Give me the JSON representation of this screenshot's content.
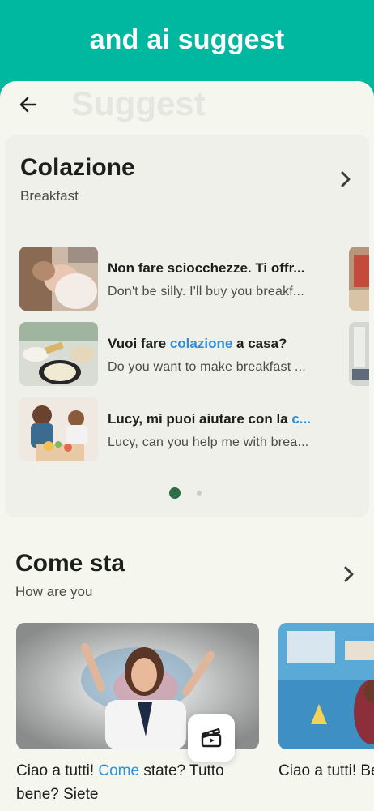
{
  "banner": {
    "title": "and ai suggest"
  },
  "header": {
    "ghost_title": "Suggest"
  },
  "breakfast": {
    "title": "Colazione",
    "subtitle": "Breakfast",
    "phrases": [
      {
        "italian": "Non fare sciocchezze. Ti offr...",
        "english": "Don't be silly. I'll buy you breakf..."
      },
      {
        "italian_before": "Vuoi fare ",
        "italian_highlight": "colazione",
        "italian_after": " a casa?",
        "english": "Do you want to make breakfast ..."
      },
      {
        "italian_before": "Lucy, mi puoi aiutare con la ",
        "italian_highlight": "c...",
        "english": "Lucy, can you help me with brea..."
      }
    ],
    "page_count": 2,
    "active_page": 1
  },
  "how_are_you": {
    "title": "Come sta",
    "subtitle": "How are you",
    "videos": [
      {
        "caption_before": "Ciao a tutti! ",
        "caption_highlight": "Come",
        "caption_after": " state? Tutto bene? Siete"
      },
      {
        "caption": "Ciao a tutti! Benvenuti, in"
      }
    ]
  },
  "colors": {
    "accent": "#00b8a0",
    "highlight": "#2f8fd8",
    "dot_active": "#2e6e46"
  }
}
